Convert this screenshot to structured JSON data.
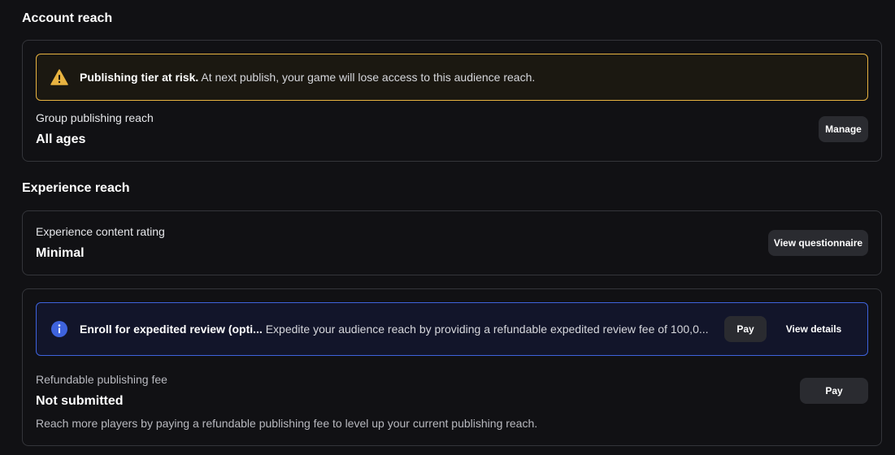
{
  "account_reach": {
    "title": "Account reach",
    "warning": {
      "icon": "warning-triangle-icon",
      "bold": "Publishing tier at risk.",
      "text": " At next publish, your game will lose access to this audience reach."
    },
    "group_label": "Group publishing reach",
    "group_value": "All ages",
    "manage_label": "Manage"
  },
  "experience_reach": {
    "title": "Experience reach",
    "rating_label": "Experience content rating",
    "rating_value": "Minimal",
    "questionnaire_label": "View questionnaire",
    "expedited": {
      "icon": "info-icon",
      "bold": "Enroll for expedited review (opti...",
      "text": "Expedite your audience reach by providing a refundable expedited review fee of 100,0...",
      "pay_label": "Pay",
      "details_label": "View details"
    },
    "fee_label": "Refundable publishing fee",
    "fee_value": "Not submitted",
    "fee_desc": "Reach more players by paying a refundable publishing fee to level up your current publishing reach.",
    "fee_pay_label": "Pay"
  },
  "colors": {
    "background": "#111114",
    "warning": "#e8b341",
    "info": "#3e63dd",
    "button": "#2a2b30"
  }
}
